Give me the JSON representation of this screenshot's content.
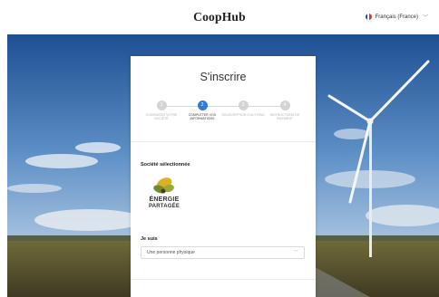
{
  "header": {
    "brand": "CoopHub",
    "language": "Français (France)",
    "flag_colors": [
      "#1f4aa8",
      "#ffffff",
      "#e0312f"
    ]
  },
  "icons": {
    "language_chevron": "chevron-down-icon",
    "select_chevron": "chevron-down-icon"
  },
  "form": {
    "title": "S'inscrire",
    "steps": [
      {
        "number": "1",
        "label": "CHOISISSEZ VOTRE SOCIÉTÉ",
        "state": "done"
      },
      {
        "number": "2",
        "label": "COMPLÉTER VOS INFORMATIONS",
        "state": "active"
      },
      {
        "number": "3",
        "label": "SOUSCRIPTION D'ACTIONS",
        "state": "upcoming"
      },
      {
        "number": "4",
        "label": "INSTRUCTIONS DE PAIEMENT",
        "state": "upcoming"
      }
    ],
    "company_section_label": "Société sélectionnée",
    "company_logo": {
      "line1": "ÉNERGIE",
      "line2": "PARTAGÉE"
    },
    "identity_label": "Je suis",
    "identity_value": "Une personne physique"
  },
  "colors": {
    "accent": "#2f7bd6",
    "step_inactive": "#d4d4d4"
  }
}
